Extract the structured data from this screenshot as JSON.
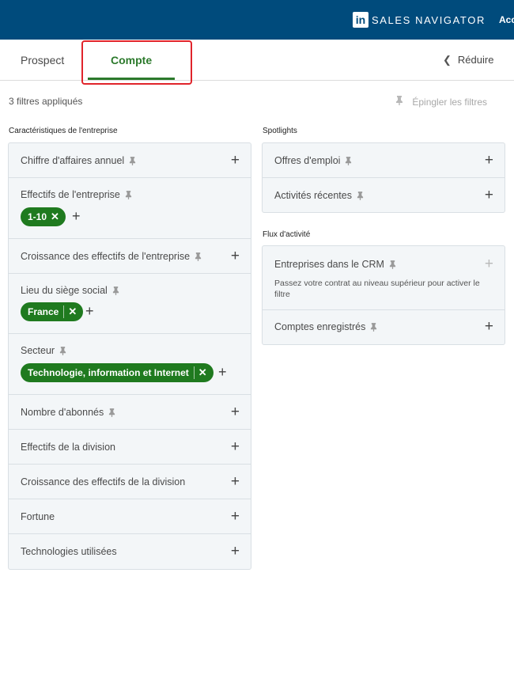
{
  "header": {
    "logo_text": "in",
    "brand": "SALES NAVIGATOR",
    "account_label": "Acc"
  },
  "tabs": {
    "prospect": "Prospect",
    "compte": "Compte",
    "reduce": "Réduire"
  },
  "filters_bar": {
    "count_text": "3 filtres appliqués",
    "pin_filters_label": "Épingler les filtres"
  },
  "company_section": {
    "title": "Caractéristiques de l'entreprise",
    "rows": {
      "revenue": "Chiffre d'affaires annuel",
      "headcount": "Effectifs de l'entreprise",
      "headcount_chip": "1-10",
      "headcount_growth": "Croissance des effectifs de l'entreprise",
      "hq": "Lieu du siège social",
      "hq_chip": "France",
      "sector": "Secteur",
      "sector_chip": "Technologie, information et Internet",
      "followers": "Nombre d'abonnés",
      "division_headcount": "Effectifs de la division",
      "division_growth": "Croissance des effectifs de la division",
      "fortune": "Fortune",
      "technologies": "Technologies utilisées"
    }
  },
  "spotlights": {
    "title": "Spotlights",
    "job_offers": "Offres d'emploi",
    "recent_activity": "Activités récentes"
  },
  "activity_flow": {
    "title": "Flux d'activité",
    "crm": "Entreprises dans le CRM",
    "crm_desc": "Passez votre contrat au niveau supérieur pour activer le filtre",
    "saved_accounts": "Comptes enregistrés"
  },
  "colors": {
    "topbar": "#004b7c",
    "accent_green": "#1f7a1f",
    "highlight_red": "#e0242b"
  }
}
